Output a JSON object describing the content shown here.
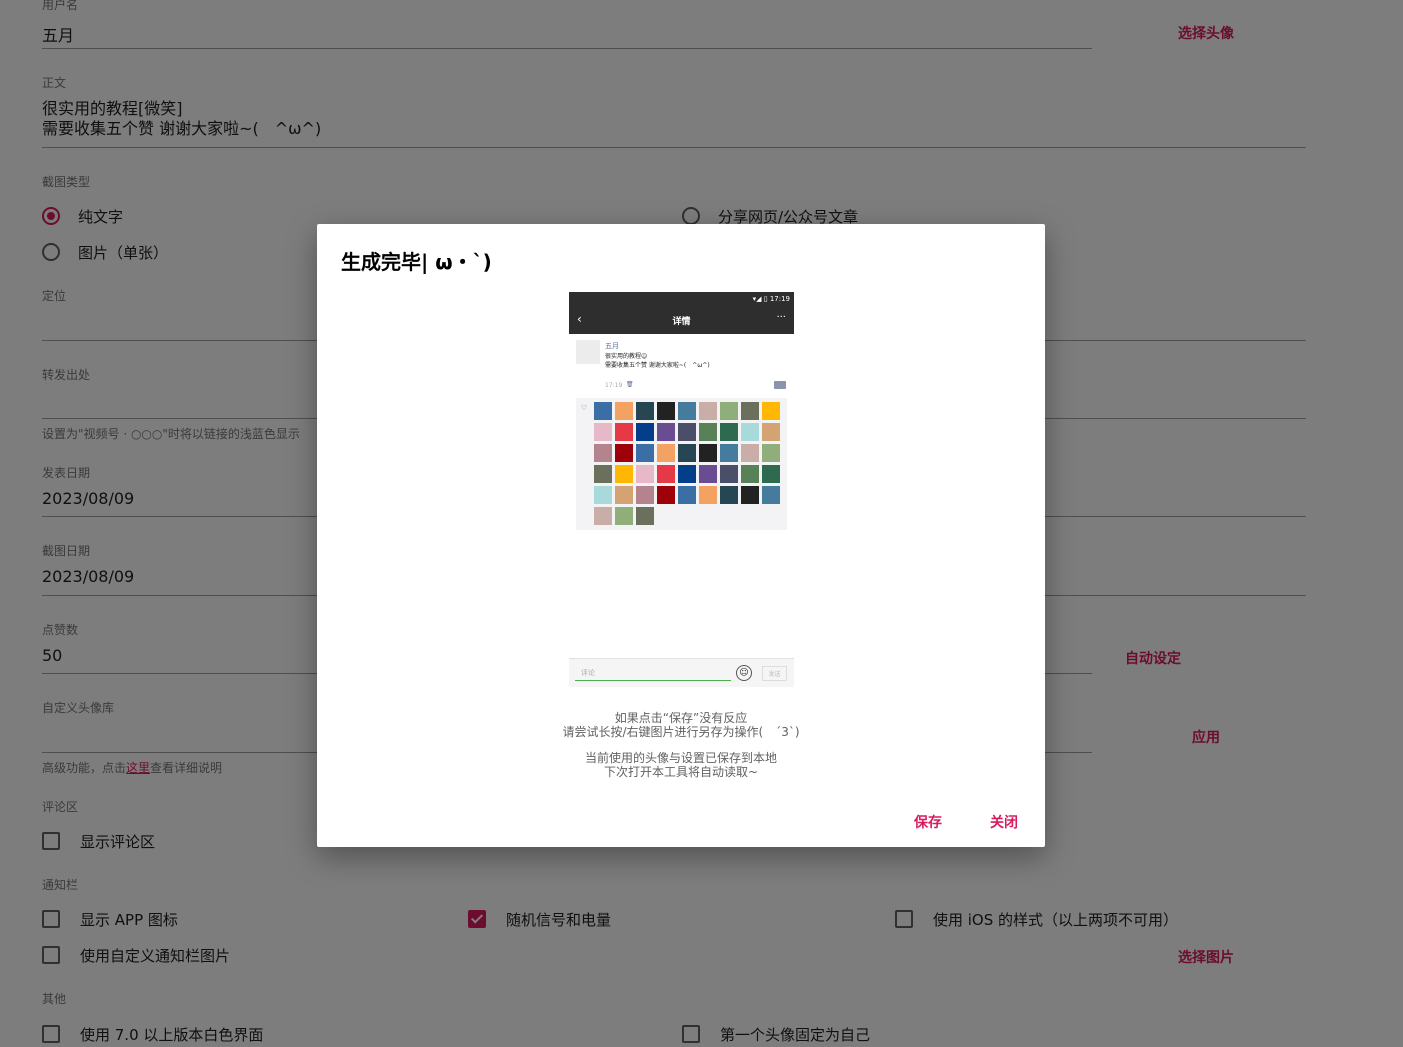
{
  "form": {
    "username_label": "用户名",
    "username_value": "五月",
    "choose_avatar": "选择头像",
    "body_label": "正文",
    "body_line1": "很实用的教程[微笑]",
    "body_line2": "需要收集五个赞 谢谢大家啦~(　^ω^)",
    "type_label": "截图类型",
    "type_text": "纯文字",
    "type_image": "图片（单张）",
    "type_share": "分享网页/公众号文章",
    "location_label": "定位",
    "forward_label": "转发出处",
    "forward_hint": "设置为\"视频号 · ○○○\"时将以链接的浅蓝色显示",
    "publish_date_label": "发表日期",
    "publish_date_value": "2023/08/09",
    "shot_date_label": "截图日期",
    "shot_date_value": "2023/08/09",
    "likes_label": "点赞数",
    "likes_value": "50",
    "auto_set": "自动设定",
    "avatar_lib_label": "自定义头像库",
    "apply": "应用",
    "adv_hint_pre": "高级功能，点击",
    "adv_hint_link": "这里",
    "adv_hint_post": "查看详细说明",
    "comment_label": "评论区",
    "show_comments": "显示评论区",
    "notif_label": "通知栏",
    "show_app_icon": "显示 APP 图标",
    "random_signal": "随机信号和电量",
    "ios_style": "使用 iOS 的样式（以上两项不可用）",
    "custom_notif": "使用自定义通知栏图片",
    "choose_image": "选择图片",
    "other_label": "其他",
    "white_ui": "使用 7.0 以上版本白色界面",
    "first_avatar_self": "第一个头像固定为自己"
  },
  "dialog": {
    "title": "生成完毕| ω・`)",
    "msg1_line1": "如果点击“保存”没有反应",
    "msg1_line2": "请尝试长按/右键图片进行另存为操作(　´3`)",
    "msg2_line1": "当前使用的头像与设置已保存到本地",
    "msg2_line2": "下次打开本工具将自动读取~",
    "save": "保存",
    "close": "关闭"
  },
  "preview": {
    "status_time": "▾◢ ▯ 17:19",
    "nav_title": "详情",
    "nav_back": "‹",
    "nav_more": "···",
    "name": "五月",
    "text_line1": "很实用的教程☺",
    "text_line2": "需要收集五个赞 谢谢大家啦~(　^ω^)",
    "time": "17:19",
    "trash": "🗑",
    "heart": "♡",
    "comment_placeholder": "评论",
    "emoji": "☺",
    "send": "发送"
  },
  "colors": {
    "accent": "#d81b60",
    "scrim": "rgba(0,0,0,0.5)"
  }
}
